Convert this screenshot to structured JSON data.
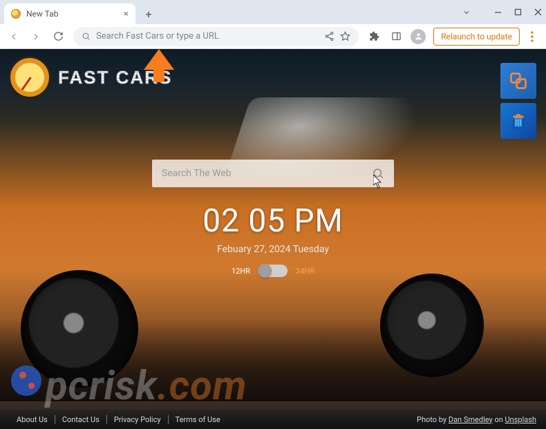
{
  "browser": {
    "tab_title": "New Tab",
    "omnibox_placeholder": "Search Fast Cars or type a URL",
    "relaunch_label": "Relaunch to update"
  },
  "page": {
    "logo_text": "FAST CARS",
    "search_placeholder": "Search The Web",
    "clock": "02 05 PM",
    "date": "Febuary 27, 2024  Tuesday",
    "toggle": {
      "left": "12HR",
      "right": "24HR"
    }
  },
  "footer": {
    "links": [
      "About Us",
      "Contact Us",
      "Privacy Policy",
      "Terms of Use"
    ],
    "credit_prefix": "Photo by ",
    "credit_author": "Dan Smedley",
    "credit_mid": " on ",
    "credit_source": "Unsplash"
  },
  "watermark": {
    "a": "pcrisk",
    "b": ".com"
  }
}
